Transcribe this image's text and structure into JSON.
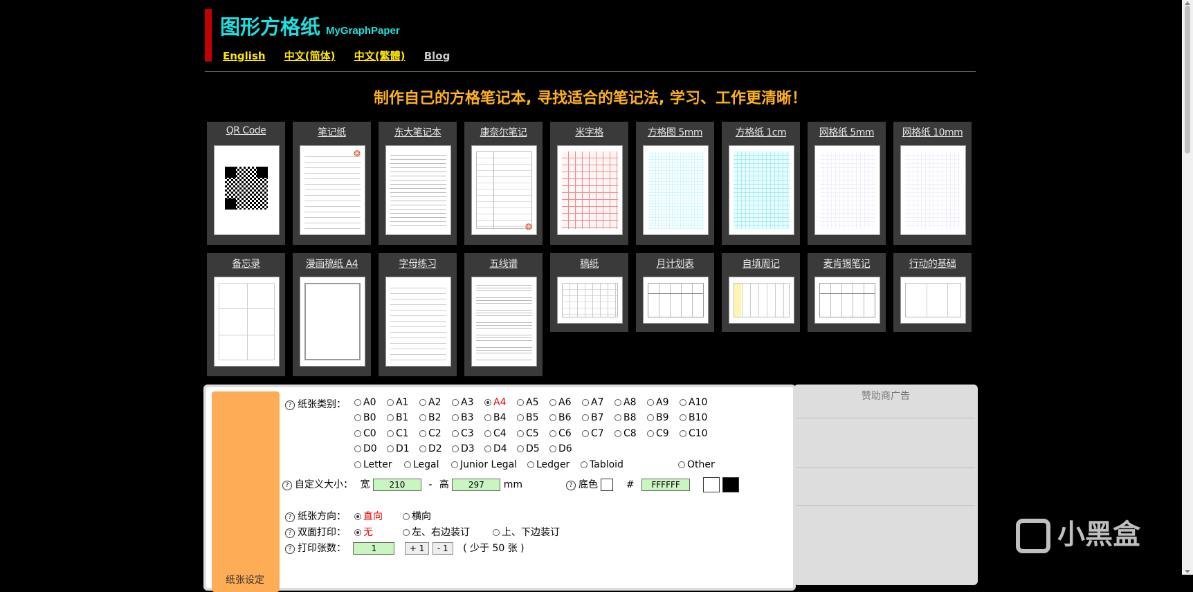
{
  "header": {
    "title": "图形方格纸",
    "subtitle": "MyGraphPaper",
    "languages": [
      "English",
      "中文(简体)",
      "中文(繁體)"
    ],
    "blog": "Blog",
    "slogan": "制作自己的方格笔记本, 寻找适合的笔记法, 学习、工作更清晰！"
  },
  "templates_row1": [
    {
      "label": "QR Code",
      "icon": "qr-code"
    },
    {
      "label": "笔记纸"
    },
    {
      "label": "东大笔记本"
    },
    {
      "label": "康奈尔笔记"
    },
    {
      "label": "米字格"
    },
    {
      "label": "方格图 5mm"
    },
    {
      "label": "方格纸 1cm"
    },
    {
      "label": "网格纸 5mm"
    },
    {
      "label": "网格纸 10mm"
    }
  ],
  "templates_row2": [
    {
      "label": "备忘录"
    },
    {
      "label": "漫画稿纸 A4"
    },
    {
      "label": "字母练习"
    },
    {
      "label": "五线谱"
    },
    {
      "label": "稿纸"
    },
    {
      "label": "月计划表"
    },
    {
      "label": "自填周记"
    },
    {
      "label": "麦肯锡笔记"
    },
    {
      "label": "行动的基础"
    }
  ],
  "settings": {
    "sidebar_label": "纸张设定",
    "help_icon": "?",
    "paper_type_label": "纸张类别：",
    "sizes": {
      "A": [
        "A0",
        "A1",
        "A2",
        "A3",
        "A4",
        "A5",
        "A6",
        "A7",
        "A8",
        "A9",
        "A10"
      ],
      "B": [
        "B0",
        "B1",
        "B2",
        "B3",
        "B4",
        "B5",
        "B6",
        "B7",
        "B8",
        "B9",
        "B10"
      ],
      "C": [
        "C0",
        "C1",
        "C2",
        "C3",
        "C4",
        "C5",
        "C6",
        "C7",
        "C8",
        "C9",
        "C10"
      ],
      "D": [
        "D0",
        "D1",
        "D2",
        "D3",
        "D4",
        "D5",
        "D6"
      ],
      "other": [
        "Letter",
        "Legal",
        "Junior Legal",
        "Ledger",
        "Tabloid"
      ],
      "custom": "Other"
    },
    "selected_size": "A4",
    "custom_size_label": "自定义大小：",
    "width_label": "宽",
    "width_value": "210",
    "dash": "-",
    "height_label": "高",
    "height_value": "297",
    "unit": "mm",
    "bgcolor_label": "底色",
    "hash": "#",
    "bgcolor_value": "FFFFFF",
    "orientation_label": "纸张方向：",
    "orientation_options": [
      "直向",
      "横向"
    ],
    "orientation_selected": "直向",
    "duplex_label": "双面打印：",
    "duplex_options": [
      "无",
      "左、右边装订",
      "上、下边装订"
    ],
    "duplex_selected": "无",
    "copies_label": "打印张数：",
    "copies_value": "1",
    "plus_label": "+ 1",
    "minus_label": "- 1",
    "copies_note": "( 少于 50 张 )"
  },
  "ad": {
    "title": "赞助商广告"
  },
  "watermark": "小黑盒",
  "colors": {
    "accent": "#1ee0e0",
    "link": "#ffe600",
    "slogan": "#ffb21a",
    "sidebar": "#ffac56",
    "input": "#c8f5c0"
  }
}
